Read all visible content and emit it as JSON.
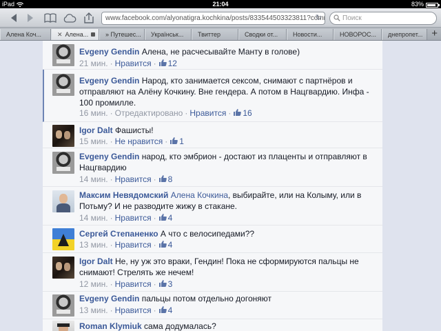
{
  "status_bar": {
    "device": "iPad",
    "time": "21:04",
    "battery": "83%"
  },
  "toolbar": {
    "url": "www.facebook.com/alyonatigra.kochkina/posts/833544503323811?comm",
    "search_placeholder": "Поиск"
  },
  "tabs": [
    {
      "label": "Алена Коч..."
    },
    {
      "label": "Алена..."
    },
    {
      "label": "» Путешес..."
    },
    {
      "label": "Українськ..."
    },
    {
      "label": "Твиттер"
    },
    {
      "label": "Сводки от..."
    },
    {
      "label": "Новости..."
    },
    {
      "label": "НОВОРОС..."
    },
    {
      "label": "днепропет..."
    }
  ],
  "comments": [
    {
      "author": "Evgeny Gendin",
      "text": "Алена, не расчесывайте Манту в голове)",
      "time": "21 мин.",
      "like_label": "Нравится",
      "likes": "12",
      "edited": ""
    },
    {
      "author": "Evgeny Gendin",
      "text": "Народ, кто занимается сексом, снимают с партнёров и отправляют на Алёну Кочкину. Вне гендера. А потом в Нацгвардию. Инфа - 100 промилле.",
      "time": "16 мин.",
      "edited": "Отредактировано",
      "like_label": "Нравится",
      "likes": "16"
    },
    {
      "author": "Igor Dalt",
      "text": "Фашисты!",
      "time": "15 мин.",
      "like_label": "Не нравится",
      "likes": "1",
      "edited": ""
    },
    {
      "author": "Evgeny Gendin",
      "text": "народ, кто эмбрион - достают из плаценты и отправляют в Нацгвардию",
      "time": "14 мин.",
      "like_label": "Нравится",
      "likes": "8",
      "edited": ""
    },
    {
      "author": "Максим Невядомский",
      "mention": "Алена Кочкина",
      "text": ", выбирайте, или на Колыму, или в Потьму? И не разводите жижу в стакане.",
      "time": "14 мин.",
      "like_label": "Нравится",
      "likes": "4",
      "edited": ""
    },
    {
      "author": "Сергей Степаненко",
      "text": "А что с велосипедами??",
      "time": "13 мин.",
      "like_label": "Нравится",
      "likes": "4",
      "edited": ""
    },
    {
      "author": "Igor Dalt",
      "text": "Не, ну уж это враки, Гендин! Пока не сформируются пальцы не снимают! Стрелять же нечем!",
      "time": "12 мин.",
      "like_label": "Нравится",
      "likes": "3",
      "edited": ""
    },
    {
      "author": "Evgeny Gendin",
      "text": "пальцы потом отдельно догоняют",
      "time": "13 мин.",
      "like_label": "Нравится",
      "likes": "4",
      "edited": ""
    },
    {
      "author": "Roman Klymiuk",
      "text": "сама додумалась?",
      "time": "",
      "like_label": "",
      "likes": "",
      "edited": ""
    }
  ]
}
